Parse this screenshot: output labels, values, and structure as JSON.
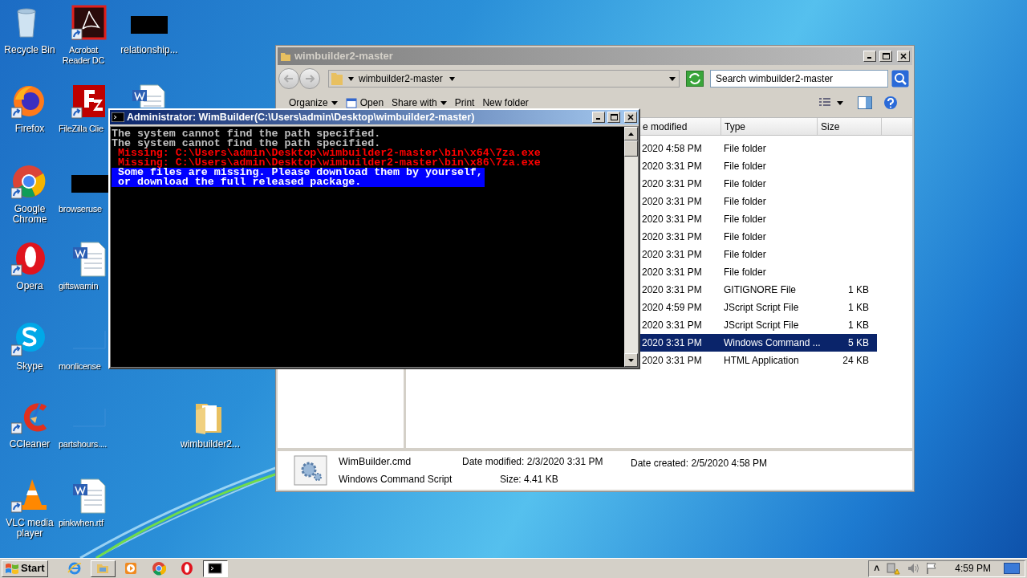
{
  "desktop": {
    "columns": [
      [
        {
          "label": "Recycle Bin",
          "kind": "recycle",
          "shortcut": false
        },
        {
          "label": "Firefox",
          "kind": "firefox",
          "shortcut": true
        },
        {
          "label": "Google Chrome",
          "kind": "chrome",
          "shortcut": true
        },
        {
          "label": "Opera",
          "kind": "opera",
          "shortcut": true
        },
        {
          "label": "Skype",
          "kind": "skype",
          "shortcut": true
        },
        {
          "label": "CCleaner",
          "kind": "ccleaner",
          "shortcut": true
        },
        {
          "label": "VLC media player",
          "kind": "vlc",
          "shortcut": true
        }
      ],
      [
        {
          "label": "Acrobat Reader DC",
          "kind": "acrobat",
          "shortcut": true
        },
        {
          "label": "FileZilla Clie",
          "kind": "filezilla",
          "shortcut": true
        },
        {
          "label": "browseruse",
          "kind": "dark",
          "shortcut": false
        },
        {
          "label": "giftswarnin",
          "kind": "word",
          "shortcut": false
        },
        {
          "label": "monlicense",
          "kind": "faint",
          "shortcut": false
        },
        {
          "label": "partshours....",
          "kind": "faint",
          "shortcut": false
        },
        {
          "label": "pinkwhen.rtf",
          "kind": "word",
          "shortcut": false
        }
      ],
      [
        {
          "label": "relationship...",
          "kind": "dark",
          "shortcut": false
        },
        {
          "kind": "word",
          "shortcut": false
        },
        null,
        null,
        null,
        null,
        null
      ],
      [
        null,
        null,
        null,
        null,
        null,
        {
          "label": "wimbuilder2...",
          "kind": "folder",
          "shortcut": false
        },
        null
      ]
    ]
  },
  "explorer": {
    "title": "wimbuilder2-master",
    "address": "wimbuilder2-master",
    "search": {
      "placeholder": "Search wimbuilder2-master"
    },
    "toolbar": [
      {
        "label": "Organize",
        "kind": "menu"
      },
      {
        "label": "Open",
        "kind": "open"
      },
      {
        "label": "Share with",
        "kind": "menu"
      },
      {
        "label": "Print",
        "kind": "plain"
      },
      {
        "label": "New folder",
        "kind": "plain"
      }
    ],
    "columns": [
      "e modified",
      "Type",
      "Size"
    ],
    "rows": [
      {
        "date": "2020 4:58 PM",
        "type": "File folder",
        "selected": false
      },
      {
        "date": "2020 3:31 PM",
        "type": "File folder",
        "selected": false
      },
      {
        "date": "2020 3:31 PM",
        "type": "File folder",
        "selected": false
      },
      {
        "date": "2020 3:31 PM",
        "type": "File folder",
        "selected": false
      },
      {
        "date": "2020 3:31 PM",
        "type": "File folder",
        "selected": false
      },
      {
        "date": "2020 3:31 PM",
        "type": "File folder",
        "selected": false
      },
      {
        "date": "2020 3:31 PM",
        "type": "File folder",
        "selected": false
      },
      {
        "date": "2020 3:31 PM",
        "type": "File folder",
        "selected": false
      },
      {
        "date": "2020 3:31 PM",
        "type": "GITIGNORE File",
        "size": "1 KB",
        "selected": false
      },
      {
        "date": "2020 4:59 PM",
        "type": "JScript Script File",
        "size": "1 KB",
        "selected": false
      },
      {
        "date": "2020 3:31 PM",
        "type": "JScript Script File",
        "size": "1 KB",
        "selected": false
      },
      {
        "date": "2020 3:31 PM",
        "type": "Windows Command ...",
        "size": "5 KB",
        "selected": true
      },
      {
        "date": "2020 3:31 PM",
        "type": "HTML Application",
        "size": "24 KB",
        "selected": false
      }
    ],
    "details": {
      "name": "WimBuilder.cmd",
      "type": "Windows Command Script",
      "modified": "Date modified: 2/3/2020 3:31 PM",
      "size": "Size: 4.41 KB",
      "created": "Date created: 2/5/2020 4:58 PM"
    }
  },
  "console": {
    "title": "Administrator:  WimBuilder(C:\\Users\\admin\\Desktop\\wimbuilder2-master)",
    "lines": [
      {
        "text": "The system cannot find the path specified.",
        "kind": "normal"
      },
      {
        "text": "The system cannot find the path specified.",
        "kind": "normal"
      },
      {
        "text": " Missing: C:\\Users\\admin\\Desktop\\wimbuilder2-master\\bin\\x64\\7za.exe",
        "kind": "error"
      },
      {
        "text": " Missing: C:\\Users\\admin\\Desktop\\wimbuilder2-master\\bin\\x86\\7za.exe",
        "kind": "error"
      },
      {
        "text": " Some files are missing. Please download them by yourself,",
        "kind": "highlight"
      },
      {
        "text": " or download the full released package.",
        "kind": "highlight"
      }
    ]
  },
  "taskbar": {
    "start": "Start",
    "items": [
      {
        "kind": "ie",
        "running": false,
        "selected": false
      },
      {
        "kind": "explorer",
        "running": true,
        "selected": false
      },
      {
        "kind": "media",
        "running": false,
        "selected": false
      },
      {
        "kind": "chrome",
        "running": false,
        "selected": false
      },
      {
        "kind": "opera",
        "running": false,
        "selected": false
      },
      {
        "kind": "cmd",
        "running": true,
        "selected": true
      }
    ],
    "tray": {
      "expand": "˄",
      "clock": "4:59 PM"
    }
  }
}
